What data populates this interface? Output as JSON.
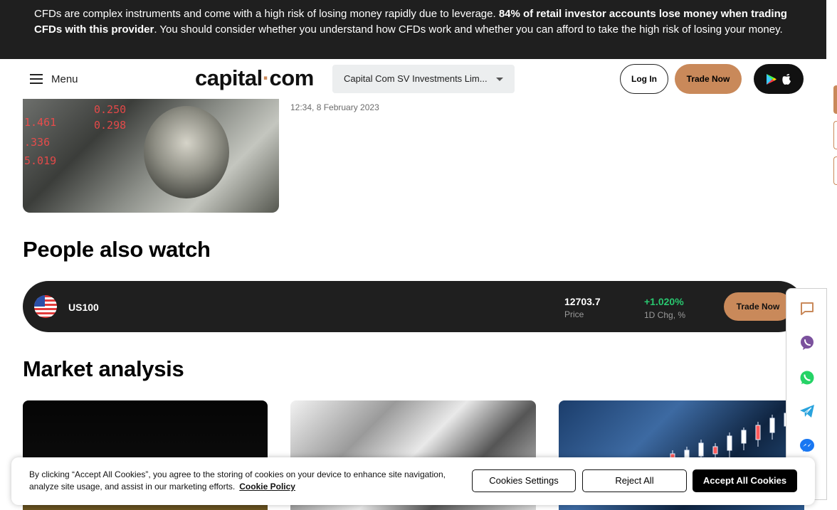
{
  "risk_banner": {
    "text_start": "CFDs are complex instruments and come with a high risk of losing money rapidly due to leverage. ",
    "text_bold": "84% of retail investor accounts lose money when trading CFDs with this provider",
    "text_end": ". You should consider whether you understand how CFDs work and whether you can afford to take the high risk of losing your money."
  },
  "header": {
    "menu_label": "Menu",
    "logo_left": "capital",
    "logo_dot": "·",
    "logo_right": "com",
    "entity_selector": "Capital Com SV Investments Lim...",
    "login_label": "Log In",
    "trade_now_label": "Trade Now",
    "app_icons": [
      "google-play-icon",
      "apple-icon"
    ]
  },
  "article": {
    "image_tickers": [
      "0.250",
      "1.461",
      ".336",
      "5.019",
      "0.298"
    ],
    "date": "12:34, 8 February 2023"
  },
  "people_also_watch": {
    "heading": "People also watch",
    "items": [
      {
        "symbol": "US100",
        "flag": "us-flag-icon",
        "price": "12703.7",
        "price_label": "Price",
        "change": "+1.020%",
        "change_label": "1D Chg, %",
        "trade_label": "Trade Now"
      }
    ]
  },
  "market_analysis": {
    "heading": "Market analysis"
  },
  "social_panel": {
    "icons": [
      "chat-icon",
      "viber-icon",
      "whatsapp-icon",
      "telegram-icon",
      "messenger-icon"
    ]
  },
  "cookie_banner": {
    "text": "By clicking “Accept All Cookies”, you agree to the storing of cookies on your device to enhance site navigation, analyze site usage, and assist in our marketing efforts.",
    "policy_link": "Cookie Policy",
    "settings_label": "Cookies Settings",
    "reject_label": "Reject All",
    "accept_label": "Accept All Cookies"
  },
  "colors": {
    "accent": "#c9895a",
    "dark": "#1f1f1f",
    "positive": "#29c76f"
  }
}
